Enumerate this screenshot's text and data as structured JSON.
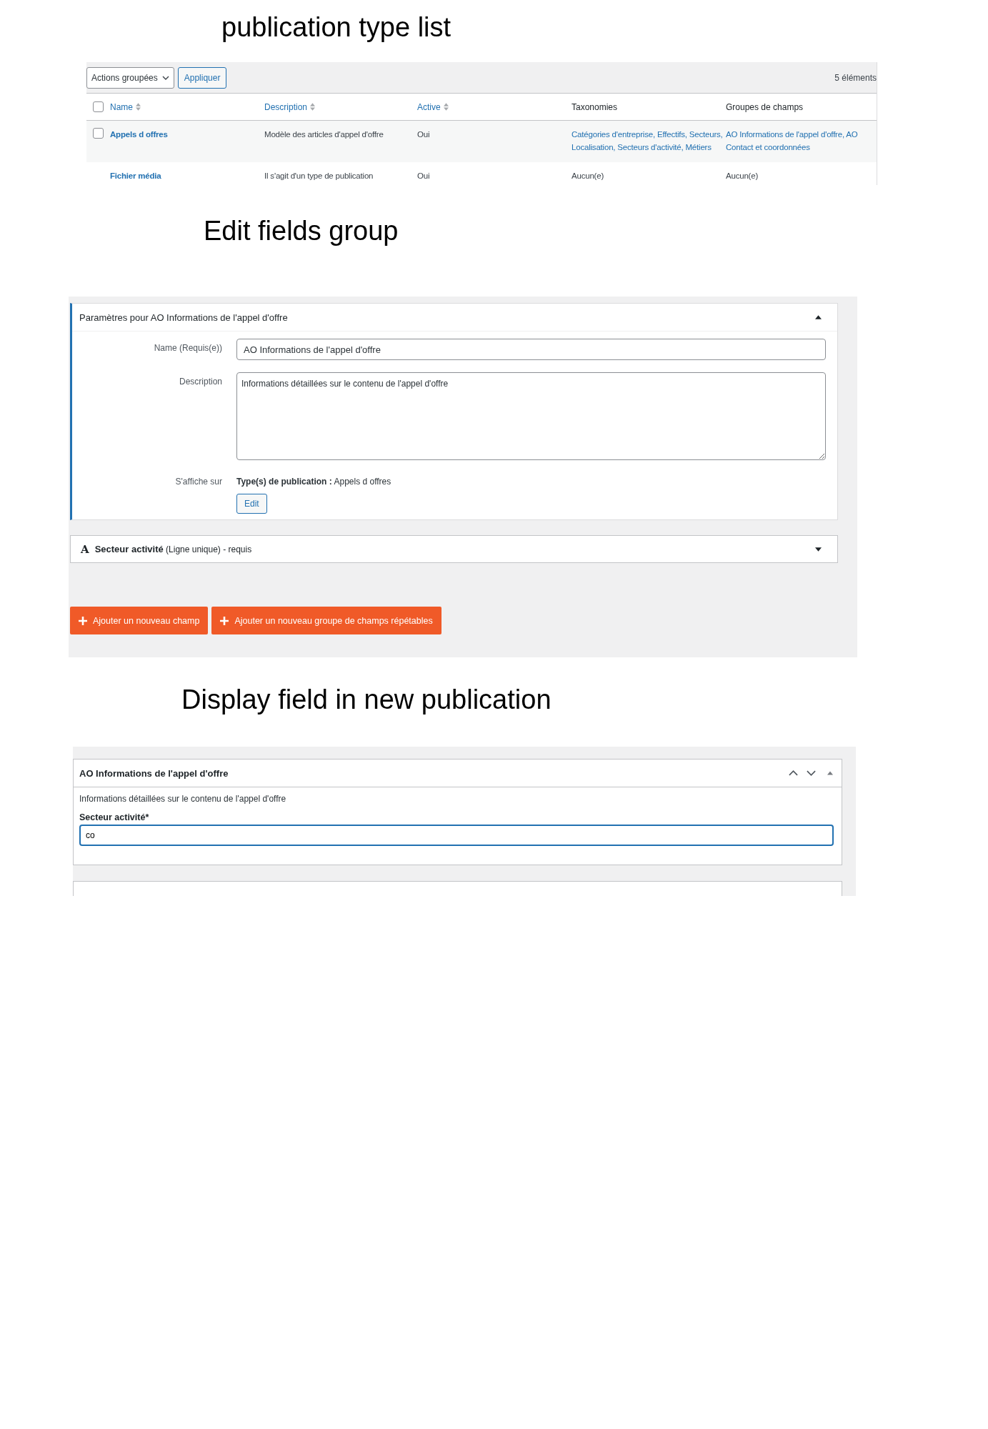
{
  "publication_list": {
    "heading": "publication type list",
    "bulk_action": "Actions groupées",
    "apply_button": "Appliquer",
    "count": "5 éléments",
    "select_all": {
      "checked": false
    },
    "columns": [
      {
        "label": "Name",
        "sortable": true
      },
      {
        "label": "Description",
        "sortable": true
      },
      {
        "label": "Active",
        "sortable": true
      },
      {
        "label": "Taxonomies",
        "sortable": false
      },
      {
        "label": "Groupes de champs",
        "sortable": false
      }
    ],
    "rows": [
      {
        "checked": false,
        "name": "Appels d offres",
        "description": "Modèle des articles d'appel d'offre",
        "active": "Oui",
        "taxonomies": {
          "text": "Catégories d'entreprise, Effectifs, Secteurs, Localisation, Secteurs d'activité, Métiers",
          "linked": true
        },
        "field_groups": {
          "text": "AO Informations de l'appel d'offre, AO Contact et coordonnées",
          "linked": true
        }
      },
      {
        "name": "Fichier média",
        "description": "Il s'agit d'un type de publication",
        "active": "Oui",
        "taxonomies": {
          "text": "Aucun(e)",
          "linked": false
        },
        "field_groups": {
          "text": "Aucun(e)",
          "linked": false
        }
      }
    ]
  },
  "edit_group": {
    "heading": "Edit fields group",
    "panel_title": "Paramètres pour AO Informations de l'appel d'offre",
    "expanded": true,
    "name_label": "Name (Requis(e))",
    "name_value": "AO Informations de l'appel d'offre",
    "description_label": "Description",
    "description_value": "Informations détaillées sur le contenu de l'appel d'offre",
    "display_label": "S'affiche sur",
    "display_value": "**Type(s) de publication :** Appels d offres",
    "edit_button": "Edit",
    "fields": [
      {
        "icon": "A",
        "title": "Secteur activité",
        "detail": "(Ligne unique) - requis",
        "expanded": false
      }
    ],
    "add_buttons": [
      "Ajouter un nouveau champ",
      "Ajouter un nouveau groupe de champs répétables"
    ]
  },
  "display": {
    "heading": "Display field in new publication",
    "box_title": "AO Informations de l'appel d'offre",
    "expanded": true,
    "description": "Informations détaillées sur le contenu de l'appel d'offre",
    "field_label": "Secteur activité*",
    "field_value": "co"
  }
}
